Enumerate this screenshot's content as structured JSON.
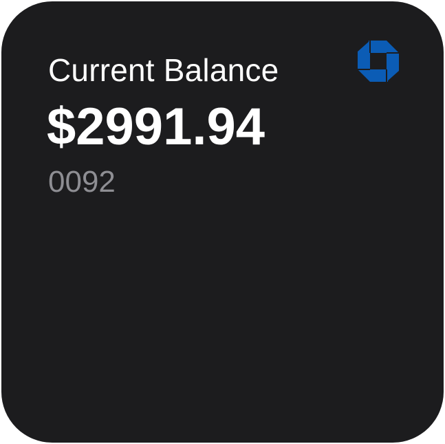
{
  "widget": {
    "label": "Current Balance",
    "balance": "$2991.94",
    "account_suffix": "0092",
    "logo_icon": "octagon-bank-logo-icon"
  },
  "colors": {
    "background": "#1c1c1e",
    "primary_text": "#ffffff",
    "secondary_text": "#8e8e93",
    "logo_blue": "#0b5cb5"
  }
}
